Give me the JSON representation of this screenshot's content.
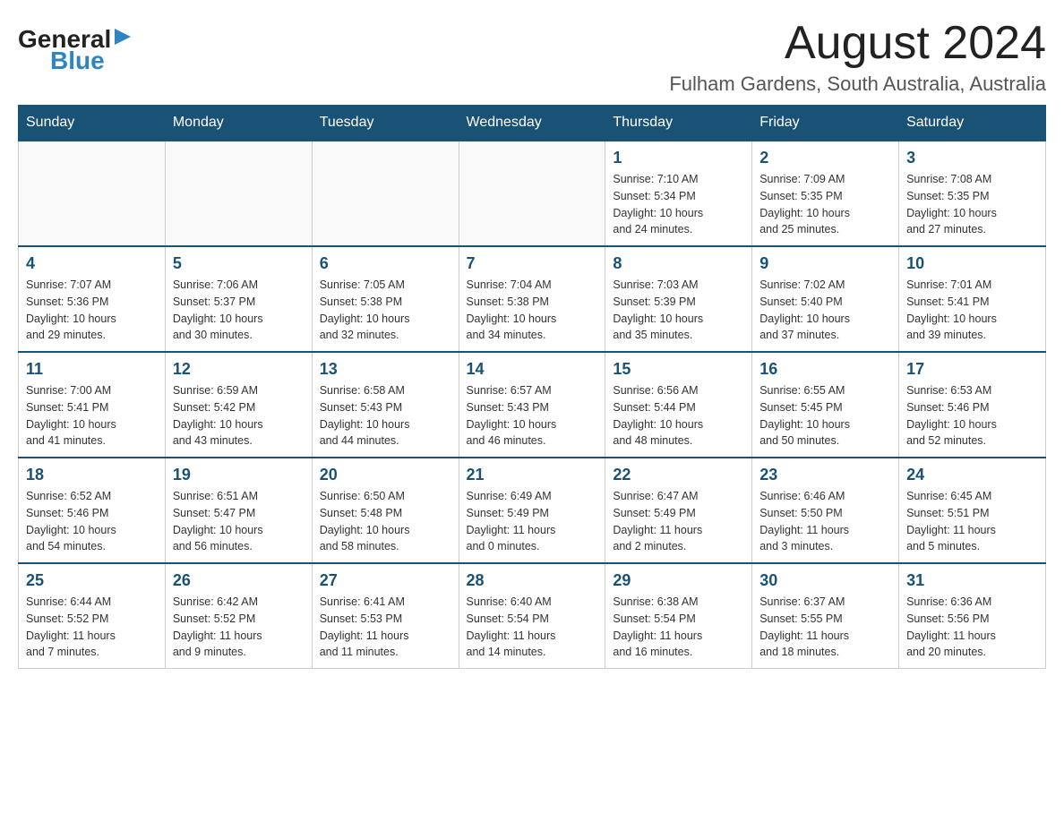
{
  "header": {
    "logo_general": "General",
    "logo_triangle": "▶",
    "logo_blue": "Blue",
    "main_title": "August 2024",
    "subtitle": "Fulham Gardens, South Australia, Australia"
  },
  "calendar": {
    "days_of_week": [
      "Sunday",
      "Monday",
      "Tuesday",
      "Wednesday",
      "Thursday",
      "Friday",
      "Saturday"
    ],
    "weeks": [
      [
        {
          "day": "",
          "info": ""
        },
        {
          "day": "",
          "info": ""
        },
        {
          "day": "",
          "info": ""
        },
        {
          "day": "",
          "info": ""
        },
        {
          "day": "1",
          "info": "Sunrise: 7:10 AM\nSunset: 5:34 PM\nDaylight: 10 hours\nand 24 minutes."
        },
        {
          "day": "2",
          "info": "Sunrise: 7:09 AM\nSunset: 5:35 PM\nDaylight: 10 hours\nand 25 minutes."
        },
        {
          "day": "3",
          "info": "Sunrise: 7:08 AM\nSunset: 5:35 PM\nDaylight: 10 hours\nand 27 minutes."
        }
      ],
      [
        {
          "day": "4",
          "info": "Sunrise: 7:07 AM\nSunset: 5:36 PM\nDaylight: 10 hours\nand 29 minutes."
        },
        {
          "day": "5",
          "info": "Sunrise: 7:06 AM\nSunset: 5:37 PM\nDaylight: 10 hours\nand 30 minutes."
        },
        {
          "day": "6",
          "info": "Sunrise: 7:05 AM\nSunset: 5:38 PM\nDaylight: 10 hours\nand 32 minutes."
        },
        {
          "day": "7",
          "info": "Sunrise: 7:04 AM\nSunset: 5:38 PM\nDaylight: 10 hours\nand 34 minutes."
        },
        {
          "day": "8",
          "info": "Sunrise: 7:03 AM\nSunset: 5:39 PM\nDaylight: 10 hours\nand 35 minutes."
        },
        {
          "day": "9",
          "info": "Sunrise: 7:02 AM\nSunset: 5:40 PM\nDaylight: 10 hours\nand 37 minutes."
        },
        {
          "day": "10",
          "info": "Sunrise: 7:01 AM\nSunset: 5:41 PM\nDaylight: 10 hours\nand 39 minutes."
        }
      ],
      [
        {
          "day": "11",
          "info": "Sunrise: 7:00 AM\nSunset: 5:41 PM\nDaylight: 10 hours\nand 41 minutes."
        },
        {
          "day": "12",
          "info": "Sunrise: 6:59 AM\nSunset: 5:42 PM\nDaylight: 10 hours\nand 43 minutes."
        },
        {
          "day": "13",
          "info": "Sunrise: 6:58 AM\nSunset: 5:43 PM\nDaylight: 10 hours\nand 44 minutes."
        },
        {
          "day": "14",
          "info": "Sunrise: 6:57 AM\nSunset: 5:43 PM\nDaylight: 10 hours\nand 46 minutes."
        },
        {
          "day": "15",
          "info": "Sunrise: 6:56 AM\nSunset: 5:44 PM\nDaylight: 10 hours\nand 48 minutes."
        },
        {
          "day": "16",
          "info": "Sunrise: 6:55 AM\nSunset: 5:45 PM\nDaylight: 10 hours\nand 50 minutes."
        },
        {
          "day": "17",
          "info": "Sunrise: 6:53 AM\nSunset: 5:46 PM\nDaylight: 10 hours\nand 52 minutes."
        }
      ],
      [
        {
          "day": "18",
          "info": "Sunrise: 6:52 AM\nSunset: 5:46 PM\nDaylight: 10 hours\nand 54 minutes."
        },
        {
          "day": "19",
          "info": "Sunrise: 6:51 AM\nSunset: 5:47 PM\nDaylight: 10 hours\nand 56 minutes."
        },
        {
          "day": "20",
          "info": "Sunrise: 6:50 AM\nSunset: 5:48 PM\nDaylight: 10 hours\nand 58 minutes."
        },
        {
          "day": "21",
          "info": "Sunrise: 6:49 AM\nSunset: 5:49 PM\nDaylight: 11 hours\nand 0 minutes."
        },
        {
          "day": "22",
          "info": "Sunrise: 6:47 AM\nSunset: 5:49 PM\nDaylight: 11 hours\nand 2 minutes."
        },
        {
          "day": "23",
          "info": "Sunrise: 6:46 AM\nSunset: 5:50 PM\nDaylight: 11 hours\nand 3 minutes."
        },
        {
          "day": "24",
          "info": "Sunrise: 6:45 AM\nSunset: 5:51 PM\nDaylight: 11 hours\nand 5 minutes."
        }
      ],
      [
        {
          "day": "25",
          "info": "Sunrise: 6:44 AM\nSunset: 5:52 PM\nDaylight: 11 hours\nand 7 minutes."
        },
        {
          "day": "26",
          "info": "Sunrise: 6:42 AM\nSunset: 5:52 PM\nDaylight: 11 hours\nand 9 minutes."
        },
        {
          "day": "27",
          "info": "Sunrise: 6:41 AM\nSunset: 5:53 PM\nDaylight: 11 hours\nand 11 minutes."
        },
        {
          "day": "28",
          "info": "Sunrise: 6:40 AM\nSunset: 5:54 PM\nDaylight: 11 hours\nand 14 minutes."
        },
        {
          "day": "29",
          "info": "Sunrise: 6:38 AM\nSunset: 5:54 PM\nDaylight: 11 hours\nand 16 minutes."
        },
        {
          "day": "30",
          "info": "Sunrise: 6:37 AM\nSunset: 5:55 PM\nDaylight: 11 hours\nand 18 minutes."
        },
        {
          "day": "31",
          "info": "Sunrise: 6:36 AM\nSunset: 5:56 PM\nDaylight: 11 hours\nand 20 minutes."
        }
      ]
    ]
  }
}
